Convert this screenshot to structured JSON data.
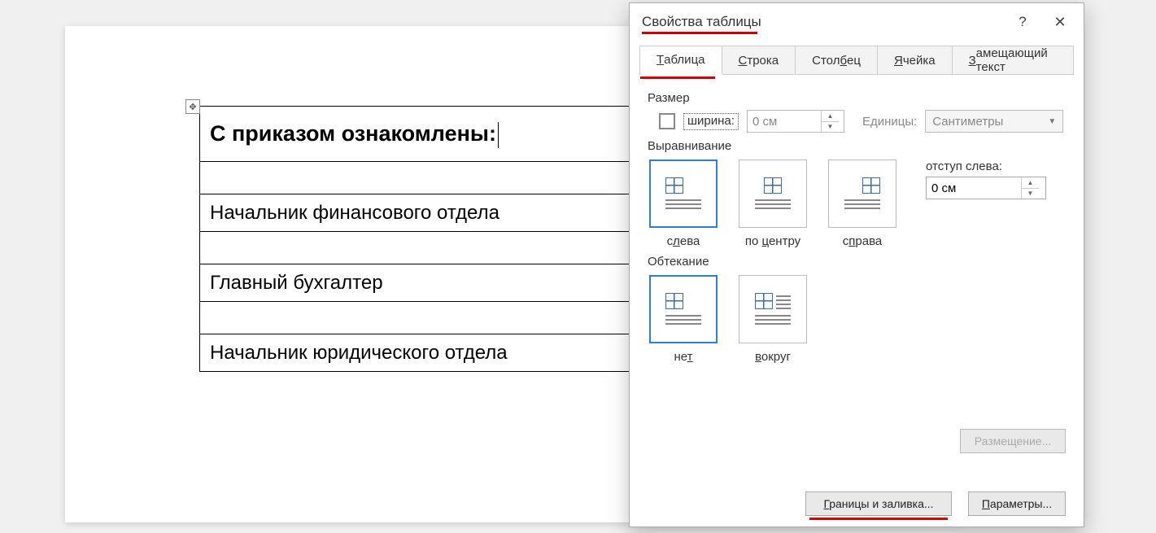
{
  "document": {
    "table_rows": [
      "С приказом ознакомлены:",
      "",
      "Начальник финансового отдела",
      "",
      "Главный бухгалтер",
      "",
      "Начальник юридического отдела"
    ]
  },
  "dialog": {
    "title": "Свойства таблицы",
    "help_symbol": "?",
    "close_symbol": "✕",
    "tabs": {
      "table": "Таблица",
      "row": "Строка",
      "column": "Столбец",
      "cell": "Ячейка",
      "alt_text": "Замещающий текст"
    },
    "groups": {
      "size": "Размер",
      "alignment": "Выравнивание",
      "wrap": "Обтекание"
    },
    "size": {
      "width_label": "ширина:",
      "width_value": "0 см",
      "units_label": "Единицы:",
      "units_value": "Сантиметры"
    },
    "alignment_options": {
      "left": "слева",
      "center": "по центру",
      "right": "справа"
    },
    "indent": {
      "label": "отступ слева:",
      "value": "0 см"
    },
    "wrap_options": {
      "none": "нет",
      "around": "вокруг"
    },
    "buttons": {
      "placement": "Размещение...",
      "borders": "Границы и заливка...",
      "params": "Параметры..."
    }
  }
}
